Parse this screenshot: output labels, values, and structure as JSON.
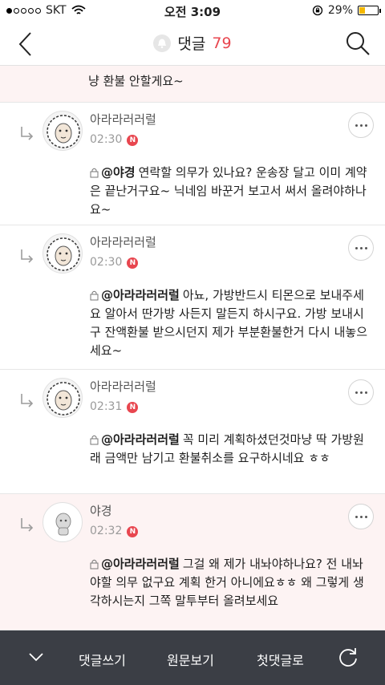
{
  "status": {
    "carrier": "SKT",
    "time": "오전 3:09",
    "battery_pct": "29%",
    "battery_level": 0.29
  },
  "header": {
    "title": "댓글",
    "count": "79",
    "icons": [
      "back-chevron-icon",
      "bell-icon",
      "search-icon"
    ]
  },
  "top_partial": {
    "line": "냥 환불 안할게요~"
  },
  "comments": [
    {
      "author": "아라라러러럴",
      "time": "02:30",
      "badge": "N",
      "mention": "@야경",
      "text": "연락할 의무가 있나요? 운송장 달고 이미 계약은 끝난거구요~ 닉네임 바꾼거 보고서 써서 올려야하나요~"
    },
    {
      "author": "아라라러러럴",
      "time": "02:30",
      "badge": "N",
      "mention": "@아라라러러럴",
      "text": "아뇨, 가방반드시 티몬으로 보내주세요 알아서 딴가방 사든지 말든지 하시구요. 가방 보내시구 잔액환불 받으시던지 제가 부분환불한거 다시 내놓으세요~"
    },
    {
      "author": "아라라러러럴",
      "time": "02:31",
      "badge": "N",
      "mention": "@아라라러러럴",
      "text": "꼭 미리 계획하셨던것마냥 딱 가방원래 금액만 남기고 환불취소를 요구하시네요 ㅎㅎ"
    },
    {
      "author": "야경",
      "time": "02:32",
      "badge": "N",
      "mention": "@아라라러러럴",
      "text": "그걸 왜 제가 내놔야하나요? 전 내놔야할 의무 없구요 계획 한거 아니에요ㅎㅎ 왜 그렇게 생각하시는지 그쪽 말투부터 올려보세요"
    }
  ],
  "bottom_bar": {
    "write": "댓글쓰기",
    "original": "원문보기",
    "first": "첫댓글로"
  },
  "colors": {
    "accent": "#e8464f",
    "highlight_bg": "#fdf3f3",
    "bottom_bar": "#3b3e45"
  }
}
